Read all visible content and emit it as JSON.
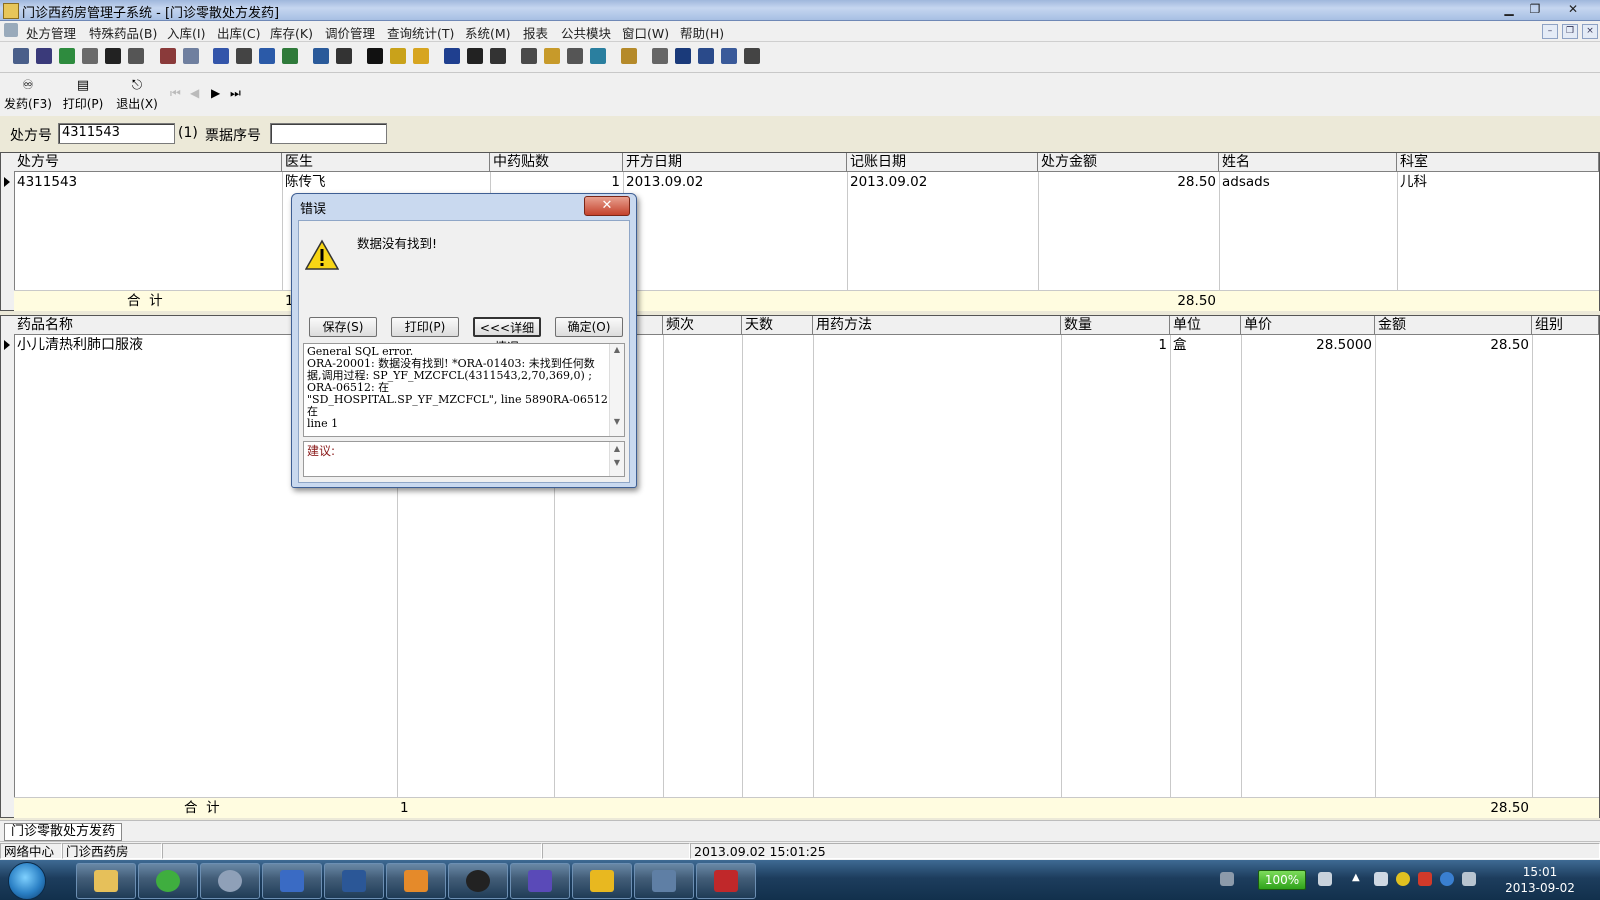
{
  "window": {
    "title": "门诊西药房管理子系统 - [门诊零散处方发药]"
  },
  "menu": [
    "处方管理",
    "特殊药品(B)",
    "入库(I)",
    "出库(C)",
    "库存(K)",
    "调价管理",
    "查询统计(T)",
    "系统(M)",
    "报表",
    "公共模块",
    "窗口(W)",
    "帮助(H)"
  ],
  "actions": {
    "dispense": "发药(F3)",
    "print": "打印(P)",
    "exit": "退出(X)"
  },
  "form": {
    "rx_label": "处方号",
    "rx_value": "4311543",
    "rx_count": "(1)",
    "ticket_label": "票据序号",
    "ticket_value": ""
  },
  "rx_grid": {
    "columns": [
      "处方号",
      "医生",
      "中药贴数",
      "开方日期",
      "记账日期",
      "处方金额",
      "姓名",
      "科室"
    ],
    "row": {
      "rx_no": "4311543",
      "doctor": "陈传飞",
      "herb_count": "1",
      "open_date": "2013.09.02",
      "bill_date": "2013.09.02",
      "amount": "28.50",
      "name": "adsads",
      "dept": "儿科"
    },
    "total_label": "合  计",
    "total_count": "1",
    "total_amount": "28.50"
  },
  "drug_grid": {
    "columns": [
      "药品名称",
      "",
      "",
      "",
      "频次",
      "天数",
      "用药方法",
      "数量",
      "单位",
      "单价",
      "金额",
      "组别"
    ],
    "row": {
      "drug_name": "小儿清热利肺口服液",
      "qty": "1",
      "unit": "盒",
      "price": "28.5000",
      "amount": "28.50"
    },
    "total_label": "合  计",
    "total_count": "1",
    "total_amount": "28.50"
  },
  "dialog": {
    "title": "错误",
    "message": "数据没有找到!",
    "buttons": {
      "save": "保存(S)",
      "print": "打印(P)",
      "details": "<<<详细情况",
      "ok": "确定(O)"
    },
    "detail_lines": [
      "General SQL error.",
      "ORA-20001: 数据没有找到! *ORA-01403: 未找到任何数",
      "据,调用过程: SP_YF_MZCFCL(4311543,2,70,369,0) ;",
      "ORA-06512: 在",
      "\"SD_HOSPITAL.SP_YF_MZCFCL\", line 5890RA-06512: 在",
      "line 1"
    ],
    "suggestion_label": "建议:"
  },
  "tabstrip": {
    "tab": "门诊零散处方发药"
  },
  "status": {
    "center": "网络中心",
    "dept": "门诊西药房",
    "datetime": "2013.09.02 15:01:25"
  },
  "taskbar": {
    "battery": "100%",
    "time": "15:01",
    "date": "2013-09-02"
  }
}
